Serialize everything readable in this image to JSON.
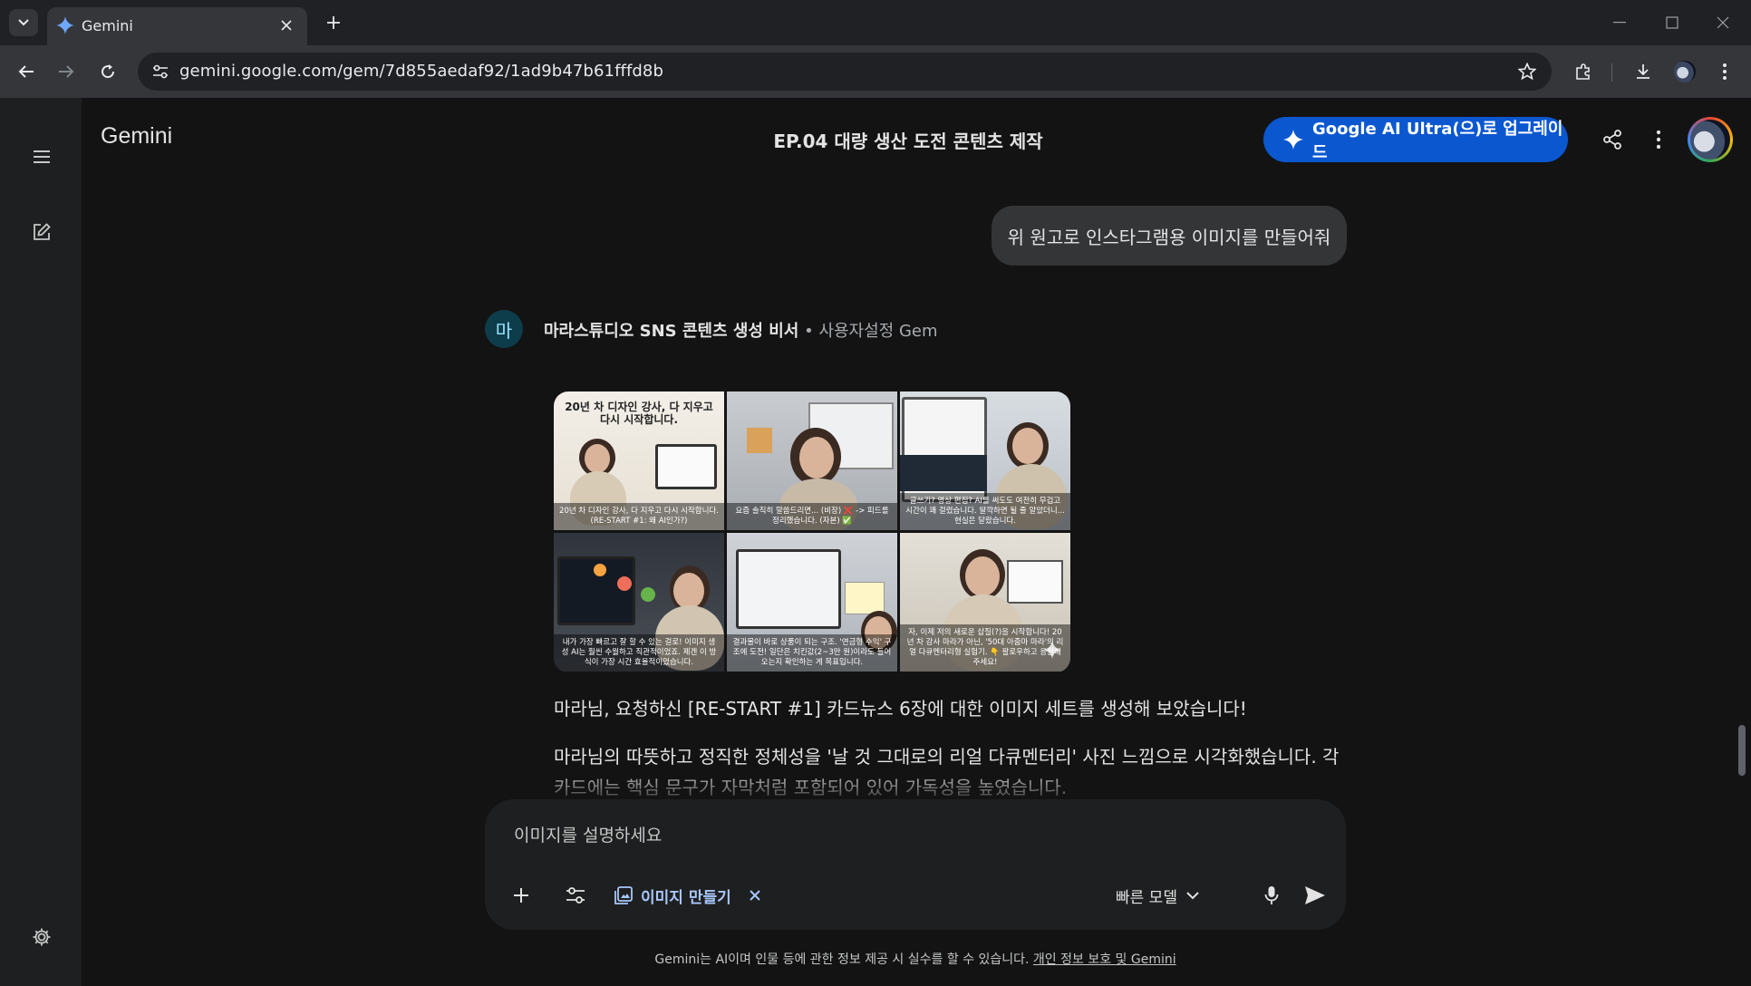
{
  "browser": {
    "tab_title": "Gemini",
    "url": "gemini.google.com/gem/7d855aedaf92/1ad9b47b61fffd8b",
    "icons": [
      "tab-list-icon",
      "gemini-favicon",
      "close-icon",
      "plus-icon",
      "minimize-icon",
      "maximize-icon",
      "close-window-icon",
      "back-icon",
      "forward-icon",
      "reload-icon",
      "site-info-icon",
      "star-icon",
      "extensions-icon",
      "download-icon",
      "profile-icon",
      "more-icon"
    ]
  },
  "app": {
    "title": "Gemini",
    "conversation_title": "EP.04 대량 생산 도전 콘텐츠 제작",
    "upgrade_label": "Google AI Ultra(으)로 업그레이드",
    "accent": "#0b57d0"
  },
  "sidebar": {
    "icons": [
      "menu-icon",
      "new-chat-icon",
      "settings-icon"
    ]
  },
  "chat": {
    "user_message": "위 원고로 인스타그램용 이미지를 만들어줘",
    "gem_avatar_letter": "마",
    "gem_name": "마라스튜디오 SNS 콘텐츠 생성 비서",
    "gem_separator": "•",
    "gem_type": "사용자설정 Gem",
    "images": [
      {
        "caption": "20년 차 디자인 강사, 다 지우고 다시 시작합니다. (RE-START #1: 왜 AI인가?)",
        "headline": "20년 차 디자인 강사, 다 지우고 다시 시작합니다."
      },
      {
        "caption": "요즘 솔직히 말씀드리면... (비장) ❌ -> 피드를 정리했습니다. (자본) ✅"
      },
      {
        "caption": "글쓰기? 영상 편집? AI를 써도도 여전히 무겁고 시간이 꽤 걸렸습니다. 딸깍하면 될 줄 알았더니... 현실은 달랐습니다."
      },
      {
        "caption": "내가 가장 빠르고 잘 할 수 있는 걸로! 이미지 생성 AI는 훨씬 수월하고 직관적이었죠. 제겐 이 방식이 가장 시간 효율적이었습니다."
      },
      {
        "caption": "결과물이 바로 상품이 되는 구조. '연금형 수익' 구조에 도전! 일단은 치킨값(2~3만 원)이라도 들어오는지 확인하는 게 목표입니다."
      },
      {
        "caption": "자, 이제 저의 새로운 삽질(?)을 시작합니다! 20년 차 강사 마라가 아닌, '50대 아줌마 마라'의 리얼 다큐멘터리형 실험기. 👇 팔로우하고 응원해 주세요!"
      }
    ],
    "answer_line1": "마라님, 요청하신 [RE-START #1] 카드뉴스 6장에 대한 이미지 세트를 생성해 보았습니다!",
    "answer_line2": "마라님의 따뜻하고 정직한 정체성을 '날 것 그대로의 리얼 다큐멘터리' 사진 느낌으로 시각화했습니다. 각 카드에는 핵심 문구가 자막처럼 포함되어 있어 가독성을 높였습니다."
  },
  "composer": {
    "placeholder": "이미지를 설명하세요",
    "value": "",
    "tool_label": "이미지 만들기",
    "model_label": "빠른 모델",
    "icons": [
      "plus-icon",
      "tools-icon",
      "image-create-icon",
      "remove-tool-icon",
      "chevron-down-icon",
      "mic-icon",
      "send-icon"
    ]
  },
  "footer": {
    "disclaimer": "Gemini는 AI이며 인물 등에 관한 정보 제공 시 실수를 할 수 있습니다.",
    "privacy_link": "개인 정보 보호 및 Gemini"
  }
}
